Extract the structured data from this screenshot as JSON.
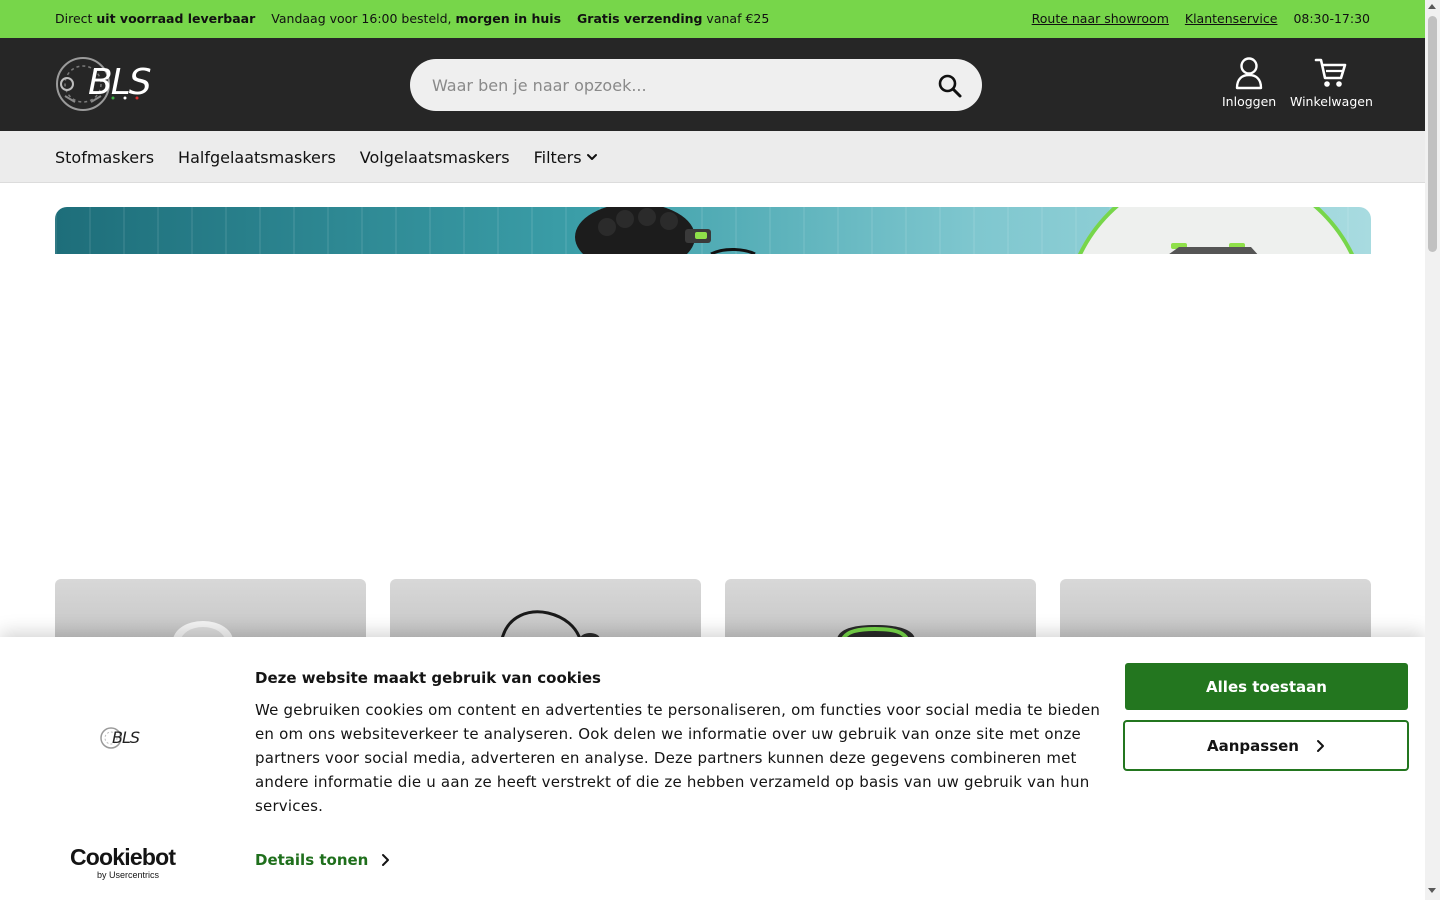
{
  "usp": {
    "item1_pre": "Direct ",
    "item1_bold": "uit voorraad leverbaar",
    "item2_pre": "Vandaag voor 16:00 besteld, ",
    "item2_bold": "morgen in huis",
    "item3_bold": "Gratis verzending",
    "item3_post": " vanaf €25",
    "route_link": "Route naar showroom",
    "service_link": "Klantenservice",
    "hours": "08:30-17:30"
  },
  "header": {
    "logo_text": "BLS",
    "search_placeholder": "Waar ben je naar opzoek...",
    "login_label": "Inloggen",
    "cart_label": "Winkelwagen"
  },
  "nav": {
    "items": [
      "Stofmaskers",
      "Halfgelaatsmaskers",
      "Volgelaatsmaskers"
    ],
    "filters_label": "Filters"
  },
  "cookie": {
    "logo_text": "BLS",
    "title": "Deze website maakt gebruik van cookies",
    "body": "We gebruiken cookies om content en advertenties te personaliseren, om functies voor social media te bieden en om ons websiteverkeer te analyseren. Ook delen we informatie over uw gebruik van onze site met onze partners voor social media, adverteren en analyse. Deze partners kunnen deze gegevens combineren met andere informatie die u aan ze heeft verstrekt of die ze hebben verzameld op basis van uw gebruik van hun services.",
    "details_label": "Details tonen",
    "allow_all_label": "Alles toestaan",
    "customize_label": "Aanpassen",
    "brand_name": "Cookiebot",
    "brand_sub": "by Usercentrics"
  },
  "colors": {
    "accent_green": "#77d64a",
    "header_dark": "#262626",
    "cookie_button_green": "#23761f",
    "nav_bg": "#ececec"
  },
  "icons": [
    "search-icon",
    "user-icon",
    "cart-icon",
    "chevron-down-icon",
    "chevron-right-icon"
  ]
}
